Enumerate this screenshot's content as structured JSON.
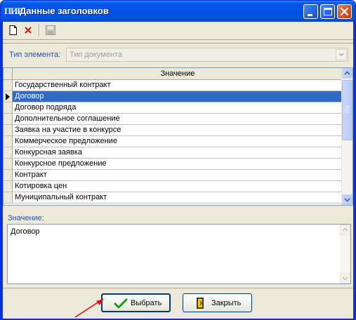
{
  "window": {
    "icon_text": "ПИР",
    "title": "Данные заголовков",
    "controls": [
      "minimize",
      "maximize",
      "close"
    ]
  },
  "toolbar": {
    "items": [
      {
        "name": "new",
        "icon": "new-document-icon",
        "enabled": true
      },
      {
        "name": "delete",
        "icon": "delete-x-icon",
        "enabled": true
      },
      {
        "name": "save",
        "icon": "save-disk-icon",
        "enabled": false
      }
    ]
  },
  "type_field": {
    "label": "Тип элемента:",
    "value": "Тип документа"
  },
  "grid": {
    "column_header": "Значение",
    "rows": [
      "Государственный контракт",
      "Договор",
      "Договор подряда",
      "Дополнительное соглашение",
      "Заявка на участие в конкурсе",
      "Коммерческое предложение",
      "Конкурсная заявка",
      "Конкурсное предложение",
      "Контракт",
      "Котировка цен",
      "Муниципальный контракт"
    ],
    "selected_index": 1
  },
  "value_field": {
    "label": "Значение:",
    "value": "Договор"
  },
  "buttons": {
    "select_label": "Выбрать",
    "close_label": "Закрыть"
  },
  "colors": {
    "selection": "#316ac5",
    "label_blue": "#2b56a7",
    "annotation_arrow": "#e01010"
  }
}
